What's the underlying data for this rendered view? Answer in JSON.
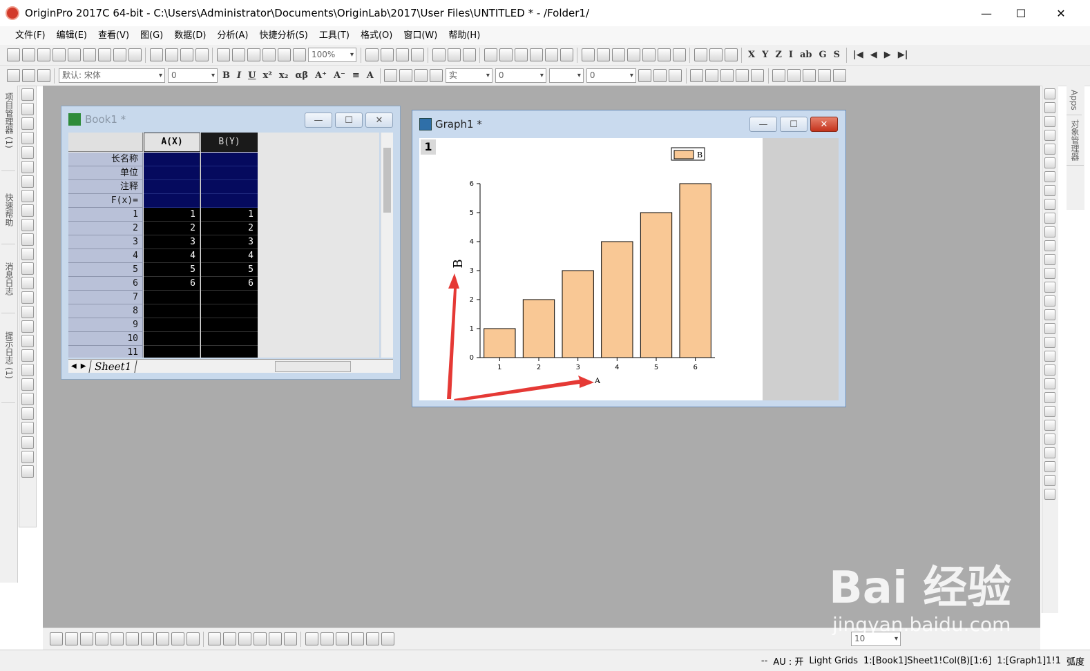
{
  "window": {
    "title": "OriginPro 2017C 64-bit - C:\\Users\\Administrator\\Documents\\OriginLab\\2017\\User Files\\UNTITLED * - /Folder1/"
  },
  "menu": [
    "文件(F)",
    "编辑(E)",
    "查看(V)",
    "图(G)",
    "数据(D)",
    "分析(A)",
    "快捷分析(S)",
    "工具(T)",
    "格式(O)",
    "窗口(W)",
    "帮助(H)"
  ],
  "toolbar": {
    "zoom": "100%",
    "font": "默认: 宋体",
    "font_size": "0",
    "line_style": "实",
    "line_width": "0",
    "num1": "0",
    "bottom_num": "10"
  },
  "left_dock": [
    "项目管理器 (1)",
    "快速帮助",
    "消息日志",
    "提示日志 (1)"
  ],
  "right_dock": [
    "Apps",
    "对象管理器"
  ],
  "book": {
    "title": "Book1 *",
    "col_a": "A(X)",
    "col_b": "B(Y)",
    "meta_rows": [
      "长名称",
      "单位",
      "注释",
      "F(x)="
    ],
    "rows": [
      "1",
      "2",
      "3",
      "4",
      "5",
      "6",
      "7",
      "8",
      "9",
      "10",
      "11"
    ],
    "a_values": [
      "1",
      "2",
      "3",
      "4",
      "5",
      "6",
      "",
      "",
      "",
      "",
      ""
    ],
    "b_values": [
      "1",
      "2",
      "3",
      "4",
      "5",
      "6",
      "",
      "",
      "",
      "",
      ""
    ],
    "sheet_tab": "Sheet1"
  },
  "graph": {
    "title": "Graph1 *",
    "layer": "1"
  },
  "chart_data": {
    "type": "bar",
    "categories": [
      "1",
      "2",
      "3",
      "4",
      "5",
      "6"
    ],
    "values": [
      1,
      2,
      3,
      4,
      5,
      6
    ],
    "series": [
      {
        "name": "B",
        "values": [
          1,
          2,
          3,
          4,
          5,
          6
        ]
      }
    ],
    "xlabel": "A",
    "ylabel": "B",
    "ylim": [
      0,
      6
    ],
    "yticks": [
      "0",
      "1",
      "2",
      "3",
      "4",
      "5",
      "6"
    ],
    "legend": "top-right",
    "bar_color": "#f9c895",
    "grid": false
  },
  "status": {
    "blank": "--",
    "au": "AU : 开",
    "grids": "Light Grids",
    "book_ref": "1:[Book1]Sheet1!Col(B)[1:6]",
    "graph_ref": "1:[Graph1]1!1",
    "unit": "弧度"
  },
  "watermark": {
    "main": "Bai 经验",
    "sub": "jingyan.baidu.com"
  },
  "colors": {
    "workspace": "#ababab",
    "bar": "#f9c895",
    "arrow": "#e53935",
    "selected_meta": "#050a5e"
  }
}
